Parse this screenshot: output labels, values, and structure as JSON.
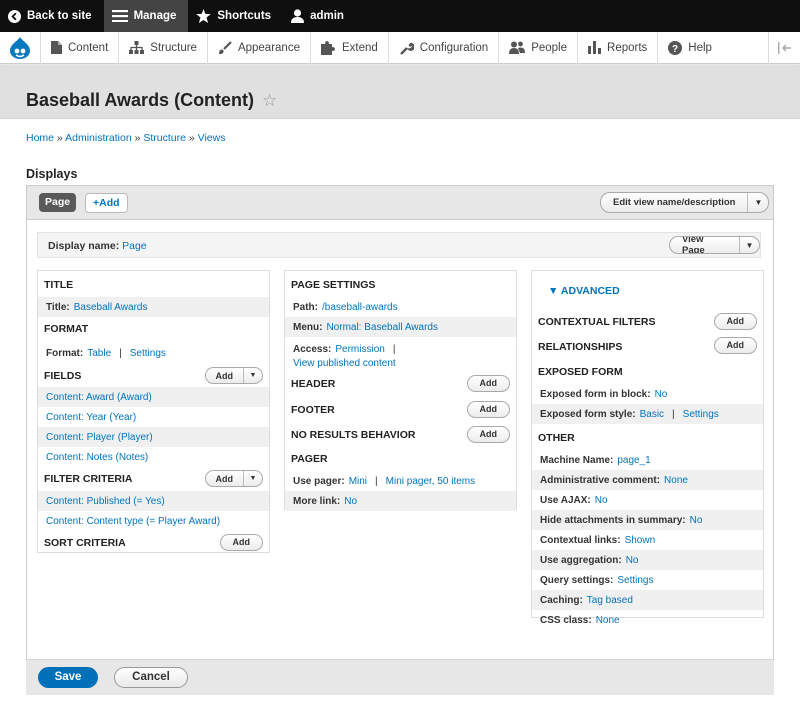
{
  "toolbar": {
    "back": "Back to site",
    "manage": "Manage",
    "shortcuts": "Shortcuts",
    "user": "admin"
  },
  "menu": {
    "content": "Content",
    "structure": "Structure",
    "appearance": "Appearance",
    "extend": "Extend",
    "configuration": "Configuration",
    "people": "People",
    "reports": "Reports",
    "help": "Help"
  },
  "page": {
    "title": "Baseball Awards (Content)"
  },
  "breadcrumb": [
    "Home",
    "Administration",
    "Structure",
    "Views"
  ],
  "displays": {
    "heading": "Displays",
    "tab_page": "Page",
    "tab_add": "+Add",
    "edit_name": "Edit view name/description",
    "display_name_label": "Display name:",
    "display_name_value": "Page",
    "view_page": "View Page"
  },
  "left": {
    "title_h": "TITLE",
    "title_label": "Title:",
    "title_value": "Baseball Awards",
    "format_h": "FORMAT",
    "format_label": "Format:",
    "format_value": "Table",
    "format_settings": "Settings",
    "fields_h": "FIELDS",
    "fields": [
      "Content: Award (Award)",
      "Content: Year (Year)",
      "Content: Player (Player)",
      "Content: Notes (Notes)"
    ],
    "filter_h": "FILTER CRITERIA",
    "filters": [
      "Content: Published (= Yes)",
      "Content: Content type (= Player Award)"
    ],
    "sort_h": "SORT CRITERIA",
    "add": "Add"
  },
  "middle": {
    "page_settings_h": "PAGE SETTINGS",
    "path_label": "Path:",
    "path_value": "/baseball-awards",
    "menu_label": "Menu:",
    "menu_value": "Normal: Baseball Awards",
    "access_label": "Access:",
    "access_value": "Permission",
    "view_published": "View published content",
    "header_h": "HEADER",
    "footer_h": "FOOTER",
    "no_results_h": "NO RESULTS BEHAVIOR",
    "pager_h": "PAGER",
    "use_pager_label": "Use pager:",
    "use_pager_value": "Mini",
    "use_pager_value2": "Mini pager, 50 items",
    "more_link_label": "More link:",
    "more_link_value": "No",
    "add": "Add"
  },
  "right": {
    "advanced": "ADVANCED",
    "contextual_h": "CONTEXTUAL FILTERS",
    "relationships_h": "RELATIONSHIPS",
    "exposed_h": "EXPOSED FORM",
    "exposed_block_label": "Exposed form in block:",
    "exposed_block_value": "No",
    "exposed_style_label": "Exposed form style:",
    "exposed_style_value": "Basic",
    "exposed_style_settings": "Settings",
    "other_h": "OTHER",
    "other": [
      {
        "label": "Machine Name:",
        "value": "page_1"
      },
      {
        "label": "Administrative comment:",
        "value": "None"
      },
      {
        "label": "Use AJAX:",
        "value": "No"
      },
      {
        "label": "Hide attachments in summary:",
        "value": "No"
      },
      {
        "label": "Contextual links:",
        "value": "Shown"
      },
      {
        "label": "Use aggregation:",
        "value": "No"
      },
      {
        "label": "Query settings:",
        "value": "Settings"
      },
      {
        "label": "Caching:",
        "value": "Tag based"
      },
      {
        "label": "CSS class:",
        "value": "None"
      }
    ],
    "add": "Add"
  },
  "actions": {
    "save": "Save",
    "cancel": "Cancel"
  }
}
